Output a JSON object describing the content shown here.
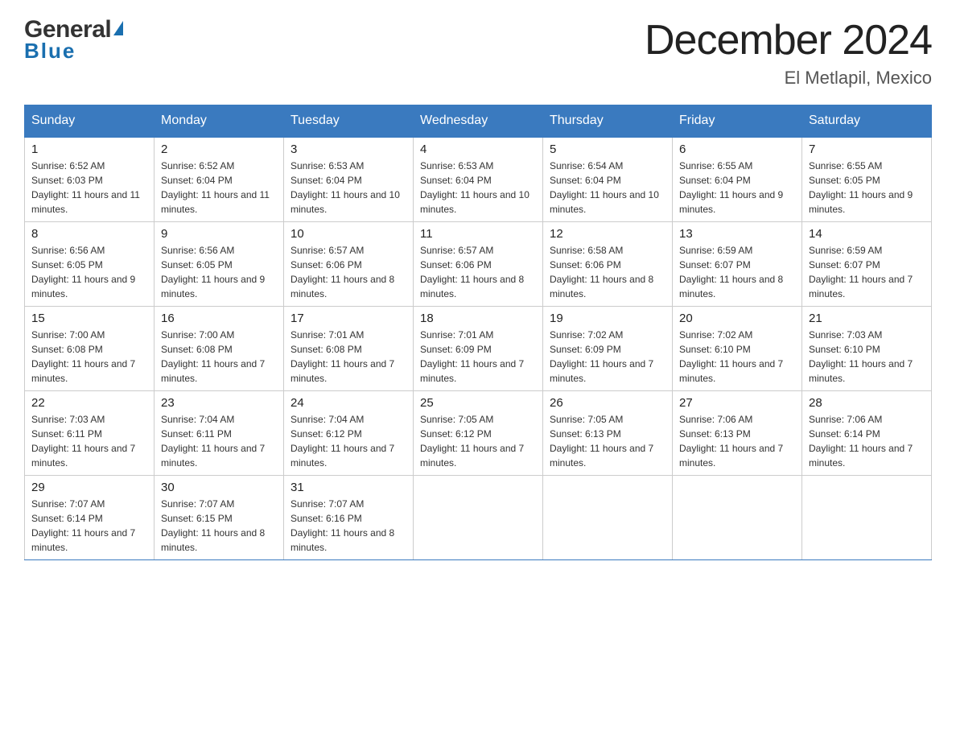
{
  "header": {
    "logo": {
      "general": "General",
      "blue": "Blue",
      "arrow": "▲"
    },
    "title": "December 2024",
    "location": "El Metlapil, Mexico"
  },
  "days_of_week": [
    "Sunday",
    "Monday",
    "Tuesday",
    "Wednesday",
    "Thursday",
    "Friday",
    "Saturday"
  ],
  "weeks": [
    [
      {
        "date": "1",
        "sunrise": "6:52 AM",
        "sunset": "6:03 PM",
        "daylight": "11 hours and 11 minutes."
      },
      {
        "date": "2",
        "sunrise": "6:52 AM",
        "sunset": "6:04 PM",
        "daylight": "11 hours and 11 minutes."
      },
      {
        "date": "3",
        "sunrise": "6:53 AM",
        "sunset": "6:04 PM",
        "daylight": "11 hours and 10 minutes."
      },
      {
        "date": "4",
        "sunrise": "6:53 AM",
        "sunset": "6:04 PM",
        "daylight": "11 hours and 10 minutes."
      },
      {
        "date": "5",
        "sunrise": "6:54 AM",
        "sunset": "6:04 PM",
        "daylight": "11 hours and 10 minutes."
      },
      {
        "date": "6",
        "sunrise": "6:55 AM",
        "sunset": "6:04 PM",
        "daylight": "11 hours and 9 minutes."
      },
      {
        "date": "7",
        "sunrise": "6:55 AM",
        "sunset": "6:05 PM",
        "daylight": "11 hours and 9 minutes."
      }
    ],
    [
      {
        "date": "8",
        "sunrise": "6:56 AM",
        "sunset": "6:05 PM",
        "daylight": "11 hours and 9 minutes."
      },
      {
        "date": "9",
        "sunrise": "6:56 AM",
        "sunset": "6:05 PM",
        "daylight": "11 hours and 9 minutes."
      },
      {
        "date": "10",
        "sunrise": "6:57 AM",
        "sunset": "6:06 PM",
        "daylight": "11 hours and 8 minutes."
      },
      {
        "date": "11",
        "sunrise": "6:57 AM",
        "sunset": "6:06 PM",
        "daylight": "11 hours and 8 minutes."
      },
      {
        "date": "12",
        "sunrise": "6:58 AM",
        "sunset": "6:06 PM",
        "daylight": "11 hours and 8 minutes."
      },
      {
        "date": "13",
        "sunrise": "6:59 AM",
        "sunset": "6:07 PM",
        "daylight": "11 hours and 8 minutes."
      },
      {
        "date": "14",
        "sunrise": "6:59 AM",
        "sunset": "6:07 PM",
        "daylight": "11 hours and 7 minutes."
      }
    ],
    [
      {
        "date": "15",
        "sunrise": "7:00 AM",
        "sunset": "6:08 PM",
        "daylight": "11 hours and 7 minutes."
      },
      {
        "date": "16",
        "sunrise": "7:00 AM",
        "sunset": "6:08 PM",
        "daylight": "11 hours and 7 minutes."
      },
      {
        "date": "17",
        "sunrise": "7:01 AM",
        "sunset": "6:08 PM",
        "daylight": "11 hours and 7 minutes."
      },
      {
        "date": "18",
        "sunrise": "7:01 AM",
        "sunset": "6:09 PM",
        "daylight": "11 hours and 7 minutes."
      },
      {
        "date": "19",
        "sunrise": "7:02 AM",
        "sunset": "6:09 PM",
        "daylight": "11 hours and 7 minutes."
      },
      {
        "date": "20",
        "sunrise": "7:02 AM",
        "sunset": "6:10 PM",
        "daylight": "11 hours and 7 minutes."
      },
      {
        "date": "21",
        "sunrise": "7:03 AM",
        "sunset": "6:10 PM",
        "daylight": "11 hours and 7 minutes."
      }
    ],
    [
      {
        "date": "22",
        "sunrise": "7:03 AM",
        "sunset": "6:11 PM",
        "daylight": "11 hours and 7 minutes."
      },
      {
        "date": "23",
        "sunrise": "7:04 AM",
        "sunset": "6:11 PM",
        "daylight": "11 hours and 7 minutes."
      },
      {
        "date": "24",
        "sunrise": "7:04 AM",
        "sunset": "6:12 PM",
        "daylight": "11 hours and 7 minutes."
      },
      {
        "date": "25",
        "sunrise": "7:05 AM",
        "sunset": "6:12 PM",
        "daylight": "11 hours and 7 minutes."
      },
      {
        "date": "26",
        "sunrise": "7:05 AM",
        "sunset": "6:13 PM",
        "daylight": "11 hours and 7 minutes."
      },
      {
        "date": "27",
        "sunrise": "7:06 AM",
        "sunset": "6:13 PM",
        "daylight": "11 hours and 7 minutes."
      },
      {
        "date": "28",
        "sunrise": "7:06 AM",
        "sunset": "6:14 PM",
        "daylight": "11 hours and 7 minutes."
      }
    ],
    [
      {
        "date": "29",
        "sunrise": "7:07 AM",
        "sunset": "6:14 PM",
        "daylight": "11 hours and 7 minutes."
      },
      {
        "date": "30",
        "sunrise": "7:07 AM",
        "sunset": "6:15 PM",
        "daylight": "11 hours and 8 minutes."
      },
      {
        "date": "31",
        "sunrise": "7:07 AM",
        "sunset": "6:16 PM",
        "daylight": "11 hours and 8 minutes."
      },
      null,
      null,
      null,
      null
    ]
  ],
  "labels": {
    "sunrise": "Sunrise:",
    "sunset": "Sunset:",
    "daylight": "Daylight:"
  }
}
